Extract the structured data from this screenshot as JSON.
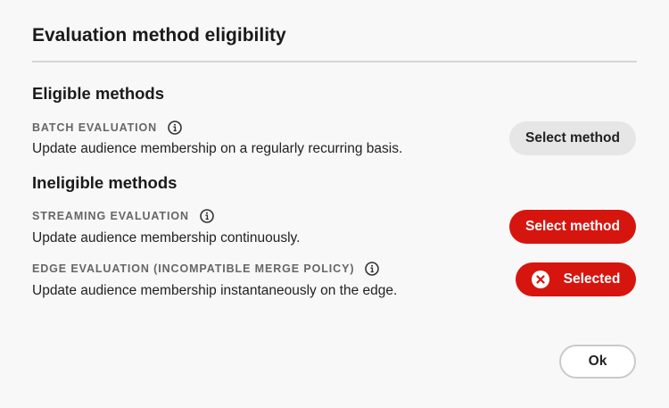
{
  "dialog": {
    "title": "Evaluation method eligibility",
    "ok_label": "Ok"
  },
  "eligible": {
    "heading": "Eligible methods",
    "methods": [
      {
        "label": "BATCH EVALUATION",
        "description": "Update audience membership on a regularly recurring basis.",
        "button_label": "Select method",
        "button_state": "default"
      }
    ]
  },
  "ineligible": {
    "heading": "Ineligible methods",
    "methods": [
      {
        "label": "STREAMING EVALUATION",
        "description": "Update audience membership continuously.",
        "button_label": "Select method",
        "button_state": "primary"
      },
      {
        "label": "EDGE EVALUATION (INCOMPATIBLE MERGE POLICY)",
        "description": "Update audience membership instantaneously on the edge.",
        "button_label": "Selected",
        "button_state": "selected"
      }
    ]
  },
  "icons": {
    "info": "info-icon",
    "selected": "close-circle-icon"
  },
  "colors": {
    "background": "#f8f8f8",
    "primary_red": "#d7150f",
    "neutral_button": "#e6e6e6",
    "label_grey": "#666666"
  }
}
